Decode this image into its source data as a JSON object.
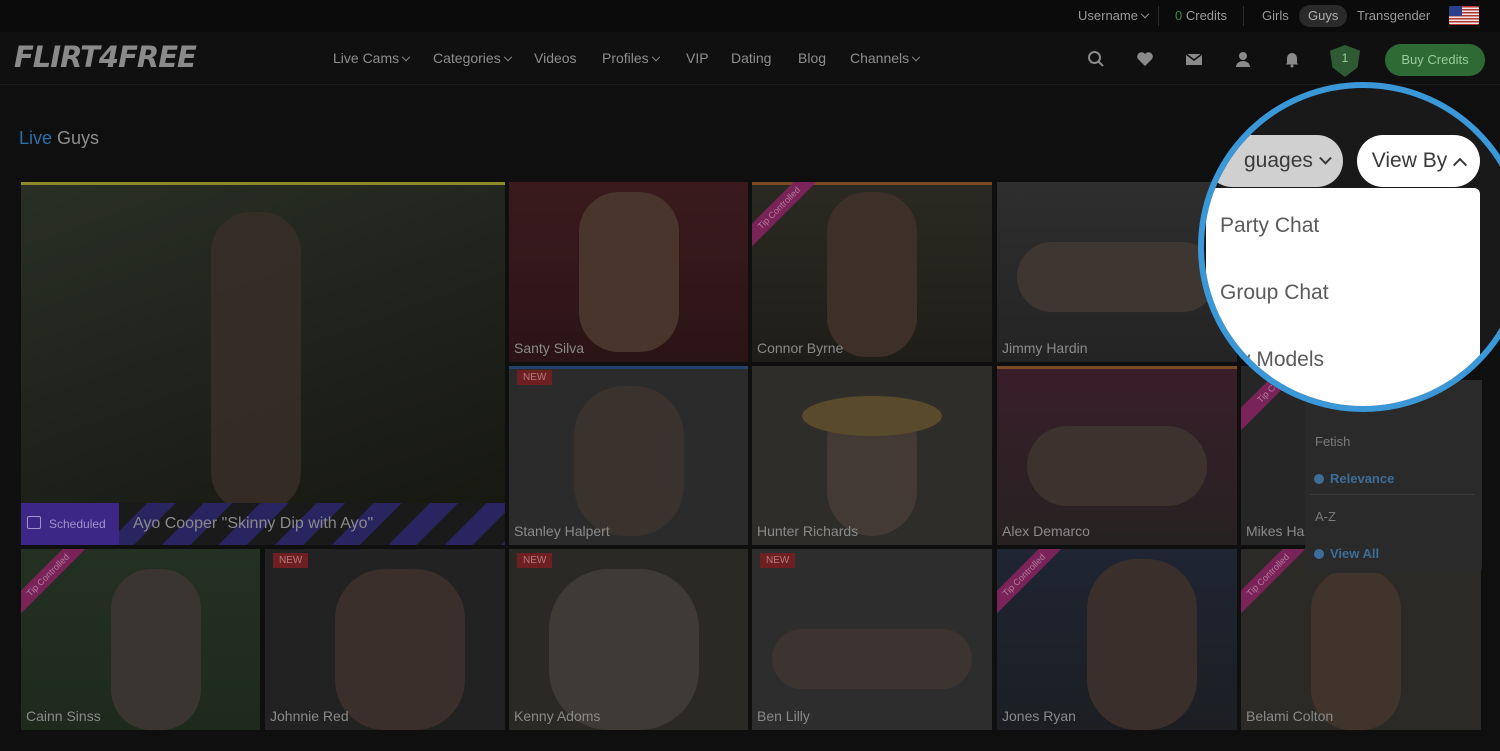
{
  "topbar": {
    "username": "Username",
    "credits_count": "0",
    "credits_label": "Credits",
    "gender_filters": [
      "Girls",
      "Guys",
      "Transgender"
    ],
    "selected_gender": "Guys"
  },
  "nav": {
    "logo": "FLIRT4FREE",
    "links": [
      "Live Cams",
      "Categories",
      "Videos",
      "Profiles",
      "VIP",
      "Dating",
      "Blog",
      "Channels"
    ],
    "notification_count": "1",
    "buy_label": "Buy Credits"
  },
  "heading": {
    "accent": "Live",
    "rest": "Guys"
  },
  "featured": {
    "name": "Ayo Cooper \"Skinny Dip with Ayo\"",
    "badge": "Scheduled"
  },
  "tiles": [
    {
      "name": "Santy Silva"
    },
    {
      "name": "Connor Byrne",
      "ribbon": "Tip Controlled"
    },
    {
      "name": "Jimmy Hardin"
    },
    {
      "name": "Stanley Halpert",
      "badge": "NEW"
    },
    {
      "name": "Hunter Richards"
    },
    {
      "name": "Alex Demarco"
    },
    {
      "name": "Mikes Ha",
      "ribbon": "Tip Co"
    },
    {
      "name": "Cainn Sinss",
      "ribbon": "Tip Controlled"
    },
    {
      "name": "Johnnie Red",
      "badge": "NEW"
    },
    {
      "name": "Kenny Adoms",
      "badge": "NEW"
    },
    {
      "name": "Ben Lilly",
      "badge": "NEW"
    },
    {
      "name": "Jones Ryan",
      "ribbon": "Tip Controlled"
    },
    {
      "name": "Belami Colton",
      "ribbon": "Tip Controlled"
    }
  ],
  "dropdown": {
    "categories": [
      "Fetish",
      "A-Z"
    ],
    "links": [
      "Relevance",
      "View All"
    ]
  },
  "zoom": {
    "languages_btn": "guages",
    "view_by_btn": "View By",
    "options": [
      "Party Chat",
      "Group Chat",
      "y Models"
    ]
  },
  "colors": {
    "accent_blue": "#3a98d8",
    "buy_green": "#2e6b34",
    "live_blue": "#2a6fa8"
  }
}
